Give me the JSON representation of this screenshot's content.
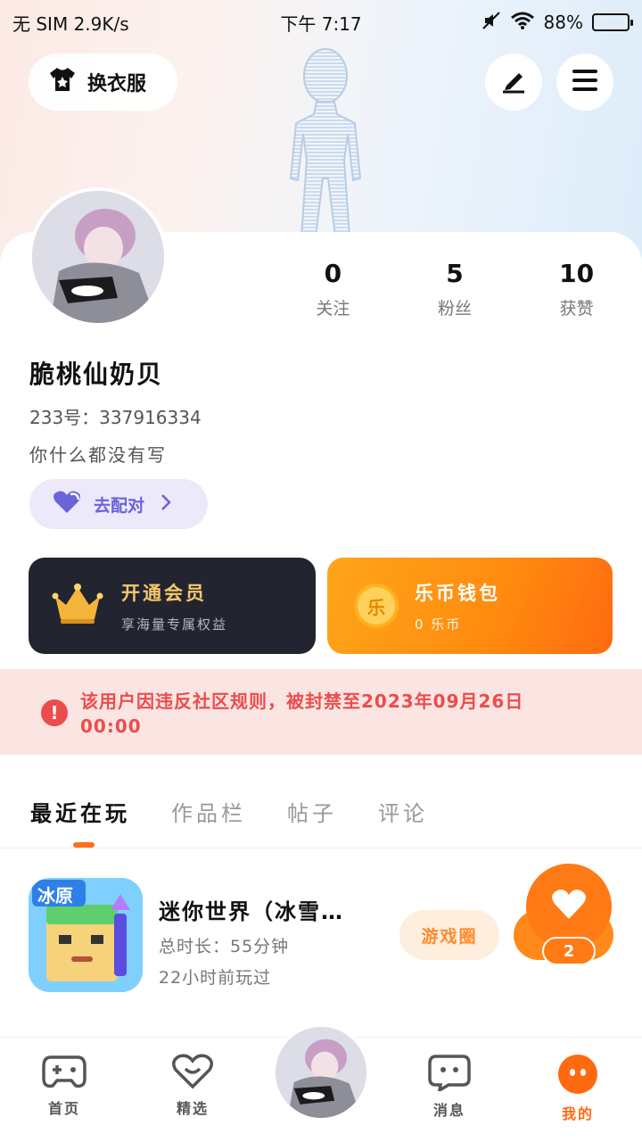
{
  "status_bar": {
    "carrier": "无 SIM 2.9K/s",
    "time": "下午 7:17",
    "battery": "88%"
  },
  "header": {
    "wardrobe_label": "换衣服"
  },
  "profile": {
    "stats": [
      {
        "value": "0",
        "label": "关注"
      },
      {
        "value": "5",
        "label": "粉丝"
      },
      {
        "value": "10",
        "label": "获赞"
      }
    ],
    "username": "脆桃仙奶贝",
    "uid": "233号：337916334",
    "bio": "你什么都没有写",
    "match_label": "去配对"
  },
  "cards": {
    "vip_title": "开通会员",
    "vip_sub": "享海量专属权益",
    "wallet_title": "乐币钱包",
    "wallet_sub": "0 乐币",
    "wallet_coin": "乐"
  },
  "ban_notice": "该用户因违反社区规则，被封禁至2023年09月26日00:00",
  "tabs": [
    "最近在玩",
    "作品栏",
    "帖子",
    "评论"
  ],
  "recent_game": {
    "name": "迷你世界（冰雪…",
    "duration": "总时长：55分钟",
    "last_played": "22小时前玩过",
    "circle_label": "游戏圈",
    "icon_text": "冰原"
  },
  "floating": {
    "like_count": "2"
  },
  "bottom_nav": [
    {
      "label": "首页"
    },
    {
      "label": "精选"
    },
    {
      "label": ""
    },
    {
      "label": "消息"
    },
    {
      "label": "我的"
    }
  ],
  "colors": {
    "accent": "#ff6a10",
    "ban": "#ec4c4c",
    "match": "#6b63d8"
  }
}
